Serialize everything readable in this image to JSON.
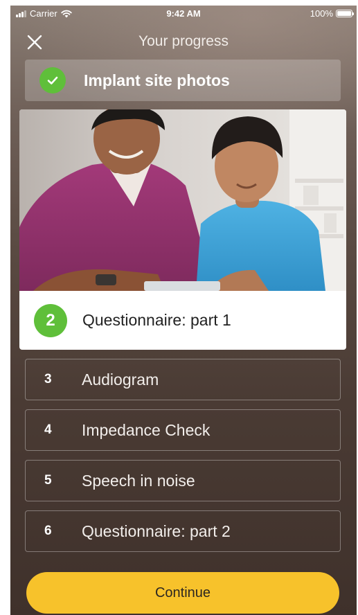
{
  "status_bar": {
    "carrier": "Carrier",
    "time": "9:42 AM",
    "battery": "100%"
  },
  "header": {
    "title": "Your progress",
    "close_icon": "close-icon"
  },
  "completed_step": {
    "label": "Implant site photos",
    "icon": "check-icon",
    "color": "#5fbf3a"
  },
  "active_step": {
    "number": "2",
    "label": "Questionnaire: part 1",
    "color": "#5fbf3a"
  },
  "steps": [
    {
      "number": "3",
      "label": "Audiogram"
    },
    {
      "number": "4",
      "label": "Impedance Check"
    },
    {
      "number": "5",
      "label": "Speech in noise"
    },
    {
      "number": "6",
      "label": "Questionnaire: part 2"
    }
  ],
  "continue_button": {
    "label": "Continue",
    "color": "#f7c22b"
  }
}
